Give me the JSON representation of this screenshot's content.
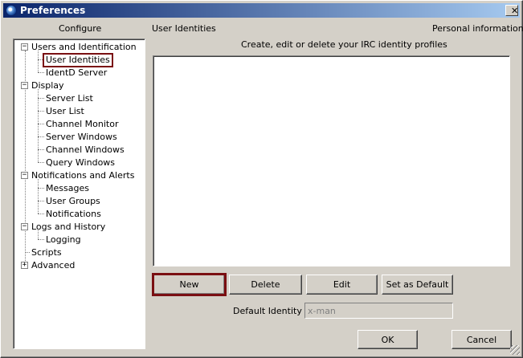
{
  "window": {
    "title": "Preferences",
    "close_label": "✕"
  },
  "headers": {
    "configure": "Configure",
    "section": "User Identities",
    "personal": "Personal information",
    "description": "Create, edit or delete your IRC identity profiles"
  },
  "tree": {
    "users": "Users and Identification",
    "user_identities": "User Identities",
    "identd": "IdentD Server",
    "display": "Display",
    "server_list": "Server List",
    "user_list": "User List",
    "channel_monitor": "Channel Monitor",
    "server_windows": "Server Windows",
    "channel_windows": "Channel Windows",
    "query_windows": "Query Windows",
    "notifications_alerts": "Notifications and Alerts",
    "messages": "Messages",
    "user_groups": "User Groups",
    "notifications": "Notifications",
    "logs_history": "Logs and History",
    "logging": "Logging",
    "scripts": "Scripts",
    "advanced": "Advanced",
    "collapse_glyph": "−",
    "expand_glyph": "+"
  },
  "buttons": {
    "new": "New",
    "delete": "Delete",
    "edit": "Edit",
    "set_default": "Set as Default",
    "ok": "OK",
    "cancel": "Cancel"
  },
  "default_identity": {
    "label": "Default Identity",
    "value": "x-man"
  },
  "colors": {
    "title_start": "#0a246a",
    "title_end": "#a6caf0",
    "highlight": "#7a0f12"
  }
}
